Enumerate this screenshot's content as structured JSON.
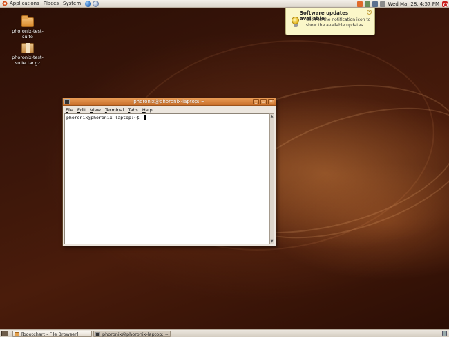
{
  "top_panel": {
    "menus": [
      "Applications",
      "Places",
      "System"
    ],
    "launchers": [
      "web-browser-icon",
      "help-icon"
    ],
    "tray_icons": [
      "update-notifier-icon",
      "network-icon",
      "volume-icon",
      "clipboard-icon"
    ],
    "clock": "Wed Mar 28,  4:57 PM"
  },
  "desktop": {
    "icons": [
      {
        "label": "phoronix-test-suite",
        "kind": "folder"
      },
      {
        "label": "phoronix-test-suite.tar.gz",
        "kind": "archive"
      }
    ]
  },
  "notification": {
    "title": "Software updates available",
    "body": "Click on the notification icon to show the available updates."
  },
  "terminal": {
    "title": "phoronix@phoronix-laptop: ~",
    "menu": [
      "File",
      "Edit",
      "View",
      "Terminal",
      "Tabs",
      "Help"
    ],
    "prompt": "phoronix@phoronix-laptop:~$ "
  },
  "bottom_panel": {
    "tasks": [
      {
        "label": "[bootchart - File Browser]",
        "active": false
      },
      {
        "label": "phoronix@phoronix-laptop: ~",
        "active": true
      }
    ]
  },
  "colors": {
    "accent": "#d5521f",
    "titlebar": "#dd8843",
    "desktop": "#3b160a"
  }
}
